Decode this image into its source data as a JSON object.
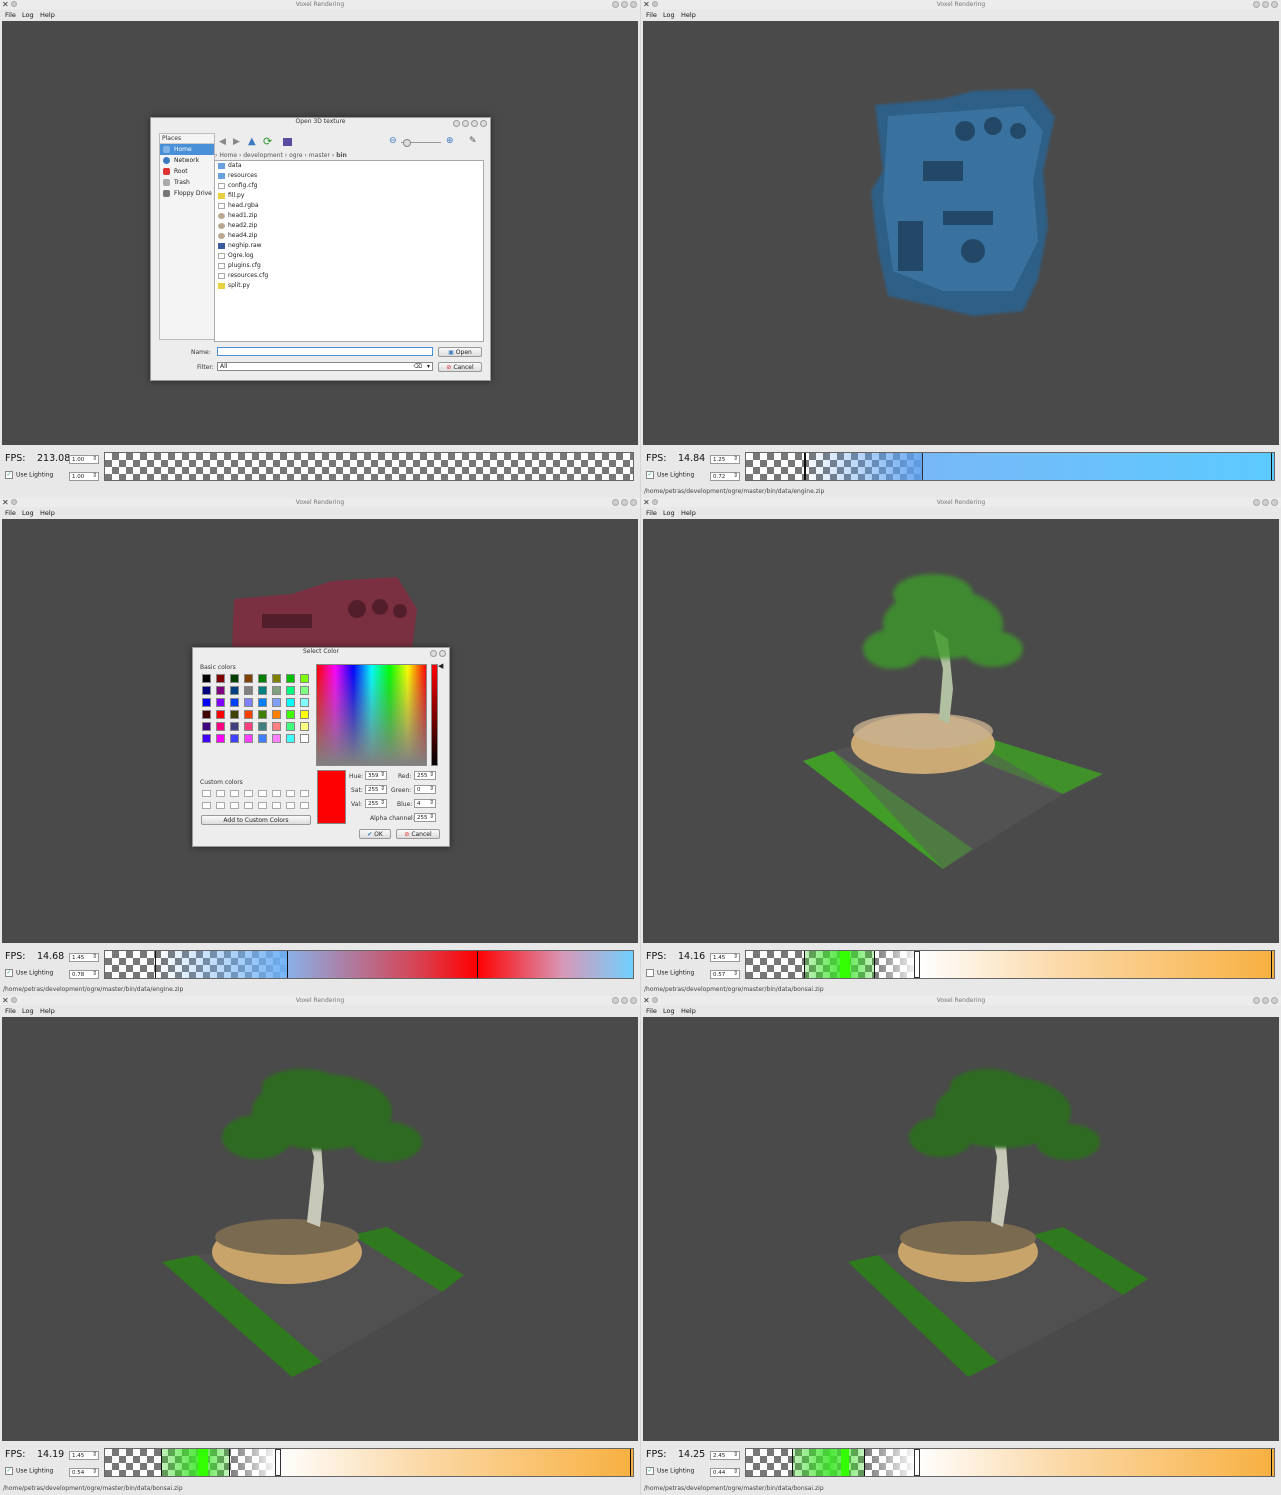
{
  "app_title": "Voxel Rendering",
  "menu": {
    "file": "File",
    "log": "Log",
    "help": "Help"
  },
  "fps_label": "FPS:",
  "lighting_label": "Use Lighting",
  "panels": [
    {
      "fps": "213.08",
      "spin1": "1.00",
      "spin2": "1.00",
      "lighting": true,
      "status": ""
    },
    {
      "fps": "14.84",
      "spin1": "1.25",
      "spin2": "0.72",
      "lighting": true,
      "status": "/home/petras/development/ogre/master/bin/data/engine.zip"
    },
    {
      "fps": "14.68",
      "spin1": "1.45",
      "spin2": "0.78",
      "lighting": true,
      "status": "/home/petras/development/ogre/master/bin/data/engine.zip"
    },
    {
      "fps": "14.16",
      "spin1": "1.45",
      "spin2": "0.57",
      "lighting": false,
      "status": "/home/petras/development/ogre/master/bin/data/bonsai.zip"
    },
    {
      "fps": "14.19",
      "spin1": "1.45",
      "spin2": "0.54",
      "lighting": true,
      "status": "/home/petras/development/ogre/master/bin/data/bonsai.zip"
    },
    {
      "fps": "14.25",
      "spin1": "2.45",
      "spin2": "0.44",
      "lighting": true,
      "status": "/home/petras/development/ogre/master/bin/data/bonsai.zip"
    }
  ],
  "open_dialog": {
    "title": "Open 3D texture",
    "places_header": "Places",
    "places": [
      "Home",
      "Network",
      "Root",
      "Trash",
      "Floppy Drive"
    ],
    "breadcrumb": [
      "Home",
      "development",
      "ogre",
      "master",
      "bin"
    ],
    "files": [
      "data",
      "resources",
      "config.cfg",
      "fill.py",
      "head.rgba",
      "head1.zip",
      "head2.zip",
      "head4.zip",
      "neghip.raw",
      "Ogre.log",
      "plugins.cfg",
      "resources.cfg",
      "split.py"
    ],
    "name_label": "Name:",
    "filter_label": "Filter:",
    "name_value": "",
    "filter_value": "All",
    "open_button": "Open",
    "cancel_button": "Cancel"
  },
  "color_dialog": {
    "title": "Select Color",
    "basic_colors_label": "Basic colors",
    "custom_colors_label": "Custom colors",
    "add_custom_button": "Add to Custom Colors",
    "hue_label": "Hue:",
    "hue": "359",
    "sat_label": "Sat:",
    "sat": "255",
    "val_label": "Val:",
    "val": "255",
    "red_label": "Red:",
    "red": "255",
    "green_label": "Green:",
    "green": "0",
    "blue_label": "Blue:",
    "blue": "4",
    "alpha_label": "Alpha channel:",
    "alpha": "255",
    "ok_button": "OK",
    "cancel_button": "Cancel",
    "basic_colors": [
      "#000000",
      "#800000",
      "#004000",
      "#804000",
      "#008000",
      "#808000",
      "#00c000",
      "#80ff00",
      "#000080",
      "#800080",
      "#004080",
      "#808080",
      "#008080",
      "#80a080",
      "#00ff80",
      "#80ff80",
      "#0000ff",
      "#8000ff",
      "#0040ff",
      "#8080ff",
      "#0080ff",
      "#80a0ff",
      "#00ffff",
      "#80ffff",
      "#400000",
      "#ff0000",
      "#404000",
      "#ff4000",
      "#408000",
      "#ff8000",
      "#40ff00",
      "#ffff00",
      "#400080",
      "#ff0080",
      "#404080",
      "#ff4080",
      "#408080",
      "#ff8080",
      "#40ff80",
      "#ffff80",
      "#4000ff",
      "#ff00ff",
      "#4040ff",
      "#ff40ff",
      "#4080ff",
      "#ff80ff",
      "#40ffff",
      "#ffffff"
    ]
  }
}
